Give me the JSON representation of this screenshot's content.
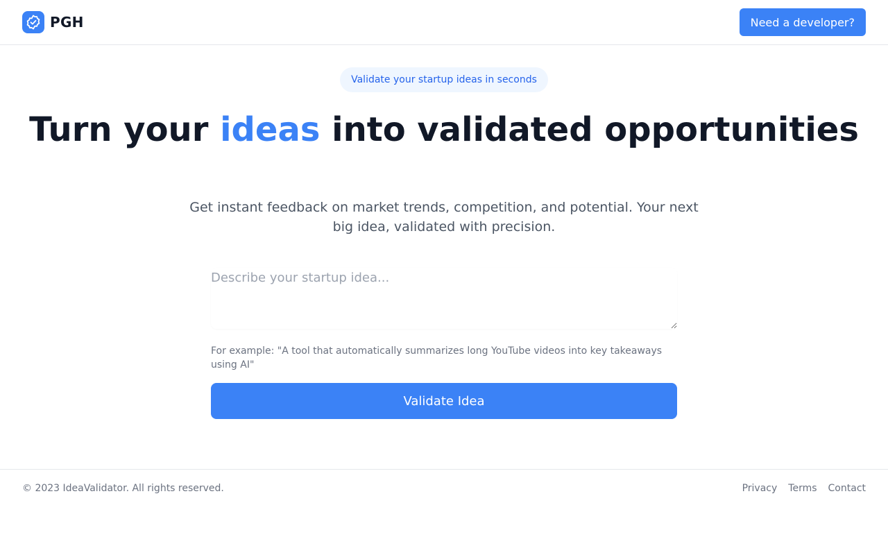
{
  "header": {
    "brand": "PGH",
    "logo_icon": "verified-badge-check-icon",
    "cta_label": "Need a developer?"
  },
  "hero": {
    "badge": "Validate your startup ideas in seconds",
    "title_before": "Turn your ",
    "title_accent": "ideas",
    "title_after": " into validated opportunities",
    "subtitle": "Get instant feedback on market trends, competition, and potential. Your next big idea, validated with precision."
  },
  "form": {
    "placeholder": "Describe your startup idea...",
    "value": "",
    "example": "For example: \"A tool that automatically summarizes long YouTube videos into key takeaways using AI\"",
    "submit_label": "Validate Idea"
  },
  "footer": {
    "copyright": "© 2023 IdeaValidator. All rights reserved.",
    "links": [
      "Privacy",
      "Terms",
      "Contact"
    ]
  },
  "colors": {
    "accent": "#3b82f6",
    "badge_bg": "#eff6ff",
    "badge_text": "#2563eb",
    "heading": "#111827",
    "muted": "#6b7280",
    "border": "#e5e7eb"
  }
}
